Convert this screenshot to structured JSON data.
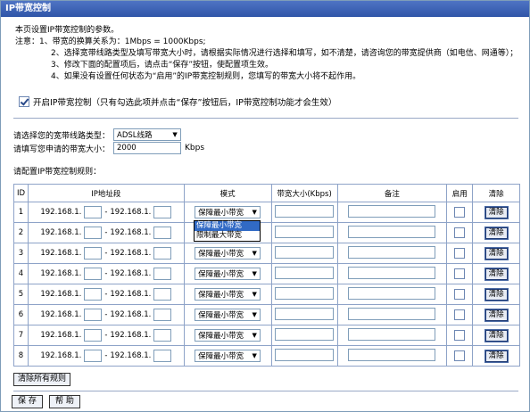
{
  "title": "IP带宽控制",
  "description": {
    "intro": "本页设置IP带宽控制的参数。",
    "note_label": "注意：",
    "notes": [
      "1、带宽的换算关系为：1Mbps = 1000Kbps;",
      "2、选择宽带线路类型及填写带宽大小时，请根据实际情况进行选择和填写，如不清楚，请咨询您的带宽提供商（如电信、网通等）；",
      "3、修改下面的配置项后，请点击“保存”按钮，使配置项生效。",
      "4、如果没有设置任何状态为“启用”的IP带宽控制规则，您填写的带宽大小将不起作用。"
    ]
  },
  "enable": {
    "checked": true,
    "label": "开启IP带宽控制（只有勾选此项并点击“保存”按钮后，IP带宽控制功能才会生效）"
  },
  "line_type": {
    "label": "请选择您的宽带线路类型：",
    "value": "ADSL线路"
  },
  "bandwidth": {
    "label": "请填写您申请的带宽大小：",
    "value": "2000",
    "unit": "Kbps"
  },
  "rules_label": "请配置IP带宽控制规则：",
  "table": {
    "headers": [
      "ID",
      "IP地址段",
      "模式",
      "带宽大小(Kbps)",
      "备注",
      "启用",
      "清除"
    ],
    "ip_prefix": "192.168.1.",
    "ip_sep": "-",
    "mode_value": "保障最小带宽",
    "clear_label": "清除",
    "ids": [
      "1",
      "2",
      "3",
      "4",
      "5",
      "6",
      "7",
      "8"
    ]
  },
  "mode_options": [
    "保障最小带宽",
    "限制最大带宽"
  ],
  "clear_all_label": "清除所有规则",
  "save_label": "保 存",
  "help_label": "帮 助"
}
